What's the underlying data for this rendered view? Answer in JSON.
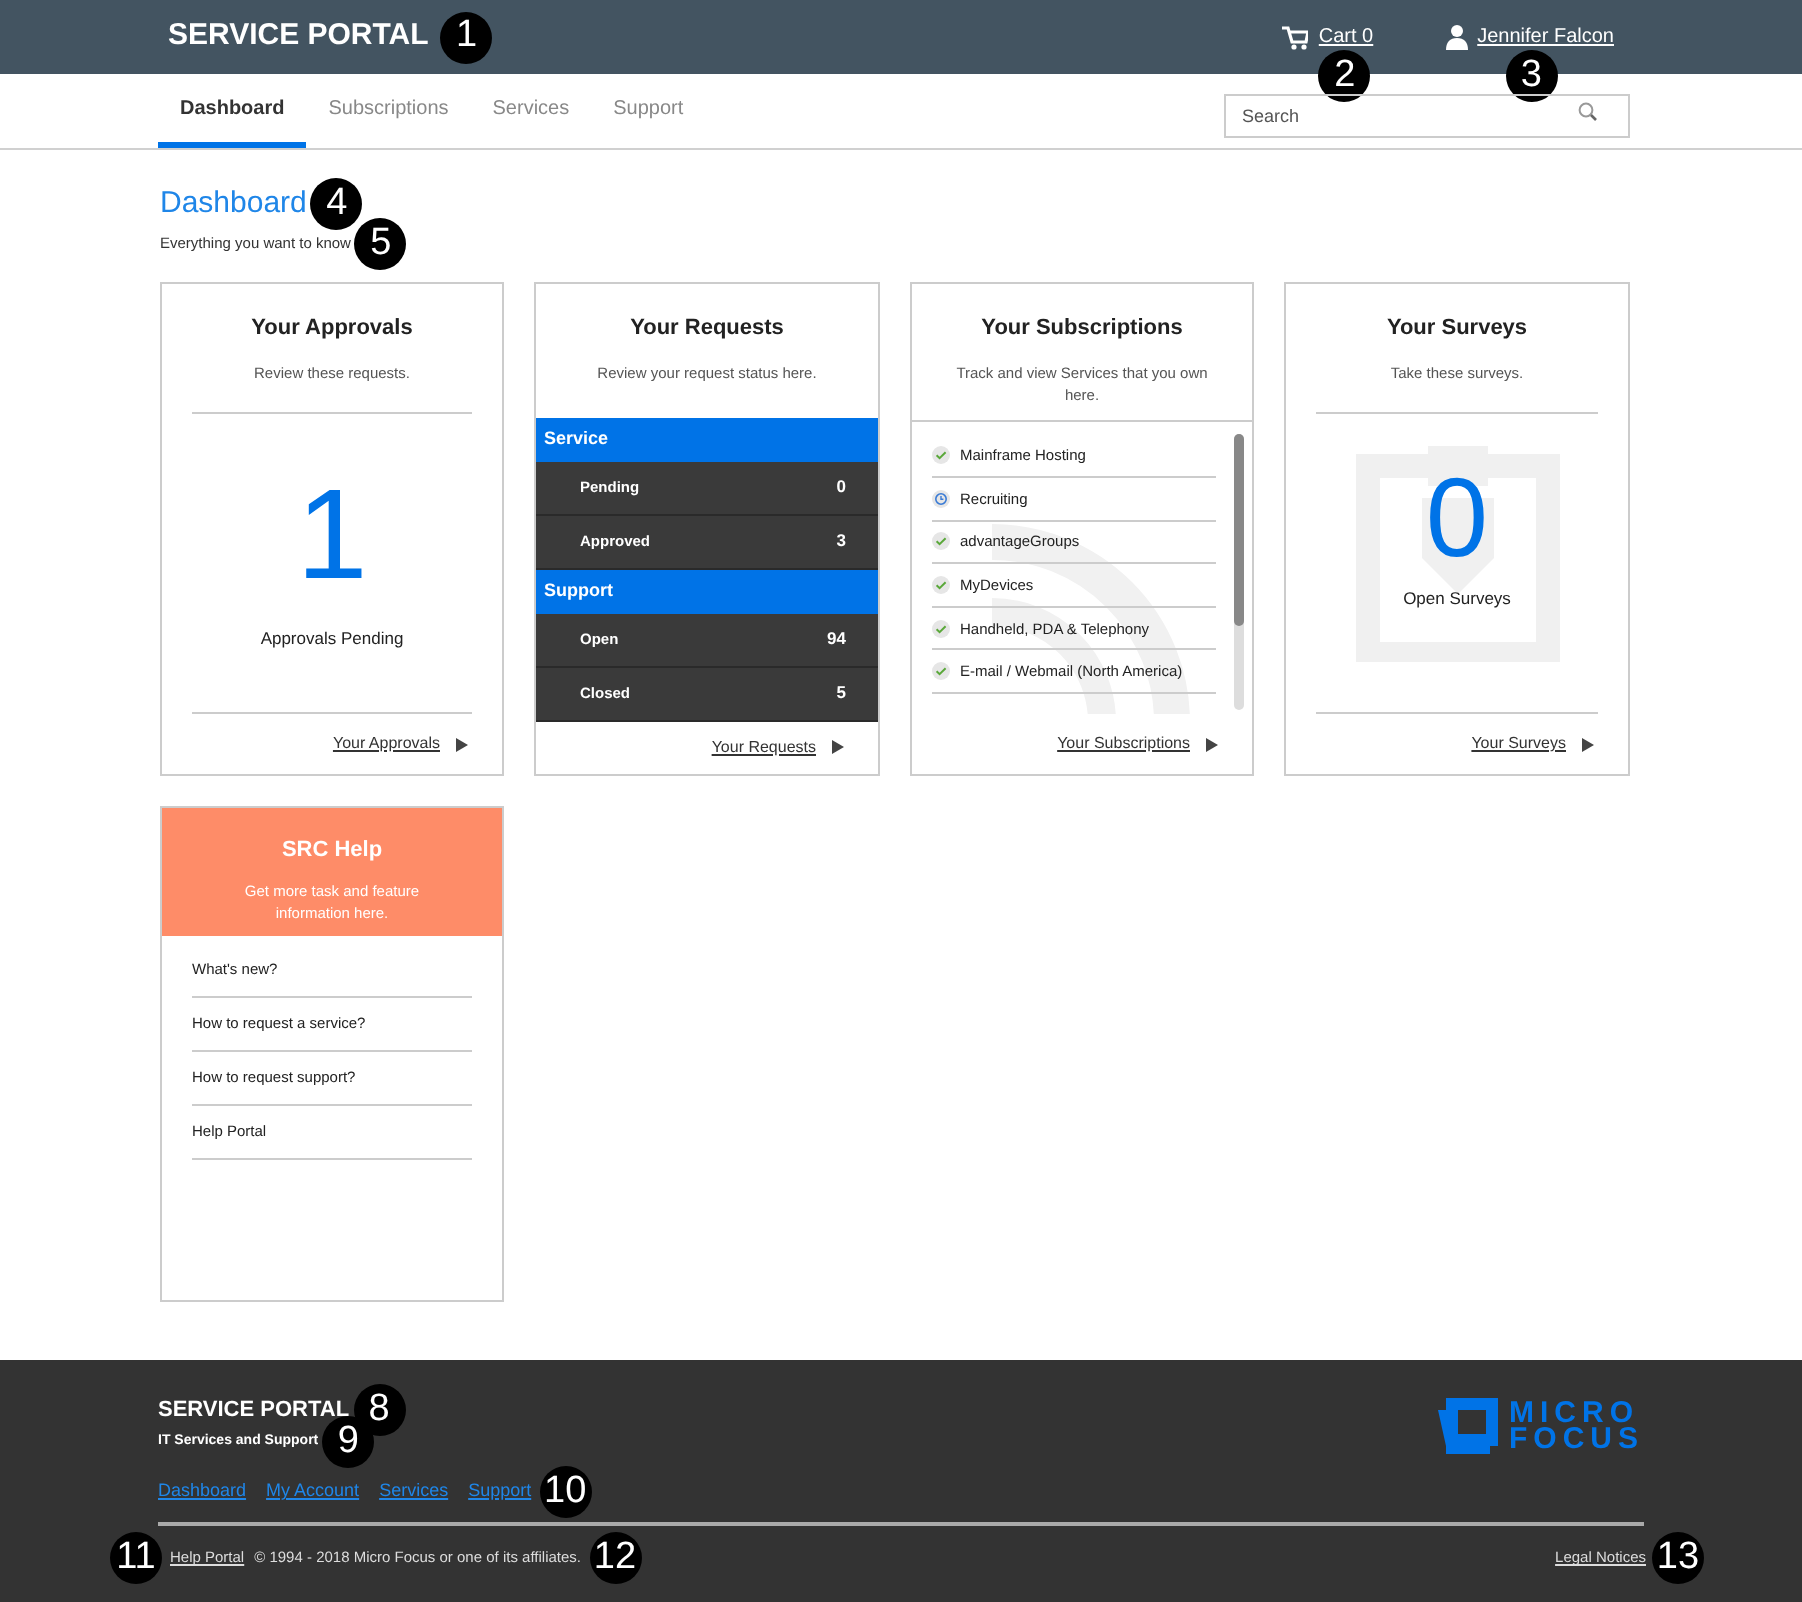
{
  "header": {
    "title": "SERVICE PORTAL",
    "title_callout": "1",
    "cart": "Cart 0",
    "cart_callout": "2",
    "user": "Jennifer Falcon",
    "user_callout": "3"
  },
  "tabs": [
    {
      "label": "Dashboard",
      "selected": true
    },
    {
      "label": "Subscriptions",
      "selected": false
    },
    {
      "label": "Services",
      "selected": false
    },
    {
      "label": "Support",
      "selected": false
    }
  ],
  "search": {
    "placeholder": "Search"
  },
  "page": {
    "title": "Dashboard",
    "title_callout": "4",
    "subtitle": "Everything you want to know",
    "subtitle_callout": "5"
  },
  "approvals": {
    "title": "Your Approvals",
    "subtitle": "Review these requests.",
    "count": "1",
    "count_label": "Approvals Pending",
    "link": "Your Approvals"
  },
  "requests": {
    "title": "Your Requests",
    "subtitle": "Review your request status here.",
    "groups": [
      {
        "name": "Service",
        "rows": [
          {
            "label": "Pending",
            "value": "0"
          },
          {
            "label": "Approved",
            "value": "3"
          }
        ]
      },
      {
        "name": "Support",
        "rows": [
          {
            "label": "Open",
            "value": "94"
          },
          {
            "label": "Closed",
            "value": "5"
          }
        ]
      }
    ],
    "link": "Your Requests"
  },
  "subscriptions": {
    "title": "Your Subscriptions",
    "subtitle": "Track and view Services that you own here.",
    "items": [
      {
        "label": "Mainframe Hosting",
        "kind": "active"
      },
      {
        "label": "Recruiting",
        "kind": "pending"
      },
      {
        "label": "advantageGroups",
        "kind": "active"
      },
      {
        "label": "MyDevices",
        "kind": "active"
      },
      {
        "label": "Handheld, PDA & Telephony",
        "kind": "active"
      },
      {
        "label": "E-mail / Webmail (North America)",
        "kind": "active"
      }
    ],
    "link": "Your Subscriptions"
  },
  "surveys": {
    "title": "Your Surveys",
    "subtitle": "Take these surveys.",
    "count": "0",
    "count_label": "Open Surveys",
    "link": "Your Surveys"
  },
  "help": {
    "title": "SRC Help",
    "subtitle": "Get more task and feature information here.",
    "links": [
      "What's new?",
      "How to request a service?",
      "How to request support?",
      "Help Portal"
    ]
  },
  "footer": {
    "title": "SERVICE PORTAL",
    "title_callout": "8",
    "subtitle": "IT Services and Support",
    "subtitle_callout": "9",
    "links": [
      "Dashboard",
      "My Account",
      "Services",
      "Support"
    ],
    "links_callout": "10",
    "logo": [
      "MICRO",
      "FOCUS"
    ],
    "help_callout": "11",
    "help_link": "Help Portal",
    "copyright": "© 1994 - 2018 Micro Focus or one of its affiliates.",
    "copyright_callout": "12",
    "legal": "Legal Notices",
    "legal_callout": "13"
  }
}
